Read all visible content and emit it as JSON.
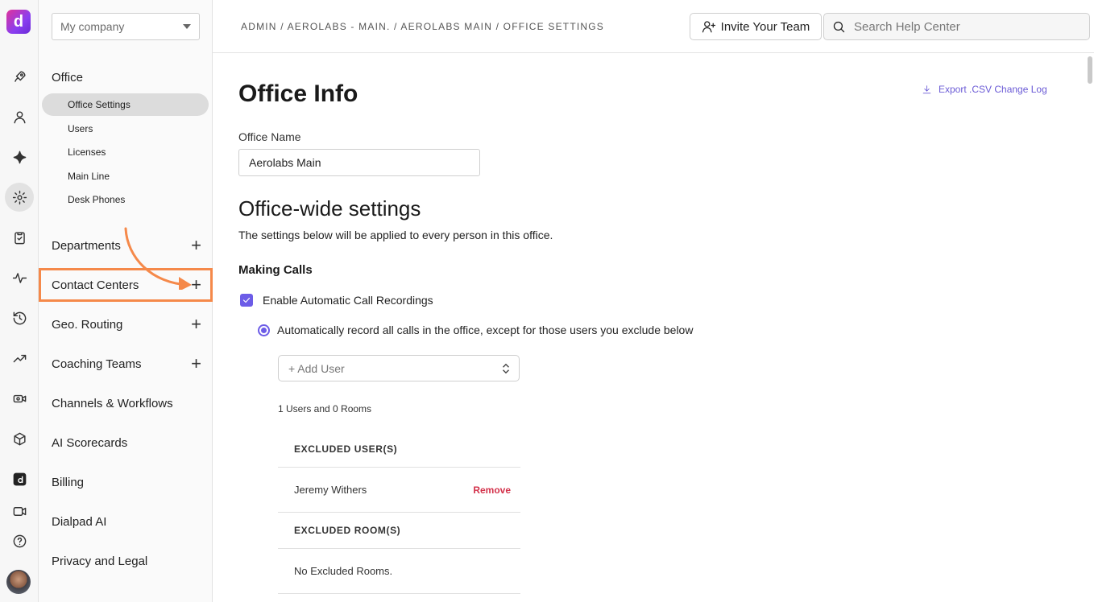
{
  "rail": {
    "logo_glyph": "d",
    "icons": [
      "rocket-icon",
      "person-icon",
      "sparkle-icon",
      "gear-icon",
      "clipboard-icon",
      "activity-icon",
      "history-icon",
      "trending-icon",
      "camera-cog-icon",
      "cube-icon",
      "dialpad-app-icon",
      "video-icon",
      "help-icon"
    ]
  },
  "sidebar": {
    "company_select": "My company",
    "office_title": "Office",
    "office_items": [
      {
        "label": "Office Settings",
        "active": true
      },
      {
        "label": "Users"
      },
      {
        "label": "Licenses"
      },
      {
        "label": "Main Line"
      },
      {
        "label": "Desk Phones"
      }
    ],
    "nav": [
      {
        "label": "Departments",
        "plus": true
      },
      {
        "label": "Contact Centers",
        "plus": true,
        "highlighted": true
      },
      {
        "label": "Geo. Routing",
        "plus": true
      },
      {
        "label": "Coaching Teams",
        "plus": true
      },
      {
        "label": "Channels & Workflows"
      },
      {
        "label": "AI Scorecards"
      },
      {
        "label": "Billing"
      },
      {
        "label": "Dialpad AI"
      },
      {
        "label": "Privacy and Legal"
      }
    ]
  },
  "topbar": {
    "breadcrumb": "ADMIN / AEROLABS - MAIN. / AEROLABS MAIN / OFFICE SETTINGS",
    "invite_label": "Invite Your Team",
    "search_placeholder": "Search Help Center"
  },
  "main": {
    "title": "Office Info",
    "export_label": "Export .CSV Change Log",
    "office_name_label": "Office Name",
    "office_name_value": "Aerolabs Main",
    "section_title": "Office-wide settings",
    "section_desc": "The settings below will be applied to every person in this office.",
    "making_calls_title": "Making Calls",
    "recording_checkbox_label": "Enable Automatic Call Recordings",
    "recording_radio_label": "Automatically record all calls in the office, except for those users you exclude below",
    "add_user_placeholder": "+ Add User",
    "count_text": "1 Users and 0 Rooms",
    "excluded_users_header": "EXCLUDED USER(S)",
    "excluded_user_name": "Jeremy Withers",
    "remove_label": "Remove",
    "excluded_rooms_header": "EXCLUDED ROOM(S)",
    "no_rooms_text": "No Excluded Rooms."
  },
  "colors": {
    "accent": "#6c5ce7",
    "highlight": "#f5894a",
    "remove": "#d3314a"
  }
}
